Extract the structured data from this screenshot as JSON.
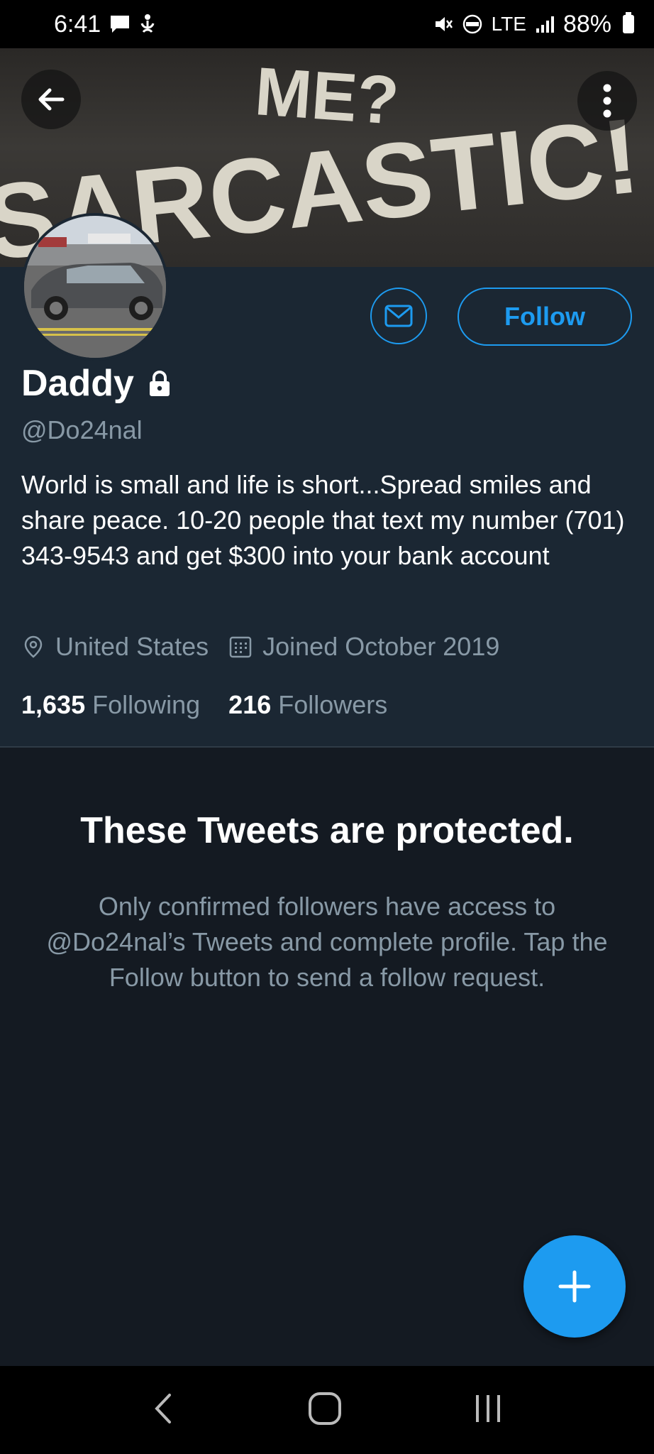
{
  "status_bar": {
    "time": "6:41",
    "network": "LTE",
    "battery_percent": "88%",
    "icons": [
      "message-icon",
      "accessibility-icon",
      "mute-icon",
      "volte-icon",
      "signal-icon",
      "battery-icon"
    ]
  },
  "banner": {
    "text_line1": "ME?",
    "text_line2": "SARCASTIC!",
    "background_color": "#3b3936"
  },
  "profile": {
    "name": "Daddy",
    "handle": "@Do24nal",
    "bio": "World is small and life is short...Spread smiles and share peace. 10-20 people that text my number (701) 343-9543 and get $300 into your bank account",
    "location": "United States",
    "joined": "Joined October 2019",
    "following_count": "1,635",
    "following_label": "Following",
    "followers_count": "216",
    "followers_label": "Followers",
    "follow_button": "Follow"
  },
  "protected": {
    "title": "These Tweets are protected.",
    "body": "Only confirmed followers have access to @Do24nal’s Tweets and complete profile. Tap the Follow button to send a follow request."
  },
  "colors": {
    "accent": "#1d9bf0",
    "panel": "#1b2733",
    "background": "#141a22",
    "muted_text": "#8899a6"
  }
}
